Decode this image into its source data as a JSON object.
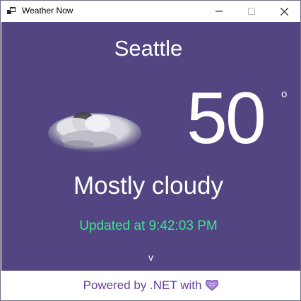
{
  "window": {
    "title": "Weather Now",
    "icon": "app-window-icon",
    "controls": [
      "minimize-icon",
      "maximize-icon",
      "close-icon"
    ]
  },
  "weather": {
    "city": "Seattle",
    "temperature": "50",
    "degree_symbol": "o",
    "condition": "Mostly cloudy",
    "condition_icon": "mostly-cloudy-icon",
    "updated": "Updated at 9:42:03 PM",
    "expand_label": "v"
  },
  "footer": {
    "text": "Powered by .NET with",
    "icon": "heart-icon"
  },
  "colors": {
    "panel_background": "#524581",
    "updated_text": "#3ce88e",
    "footer_text": "#6a3fa0",
    "heart": "#a98ad6"
  }
}
